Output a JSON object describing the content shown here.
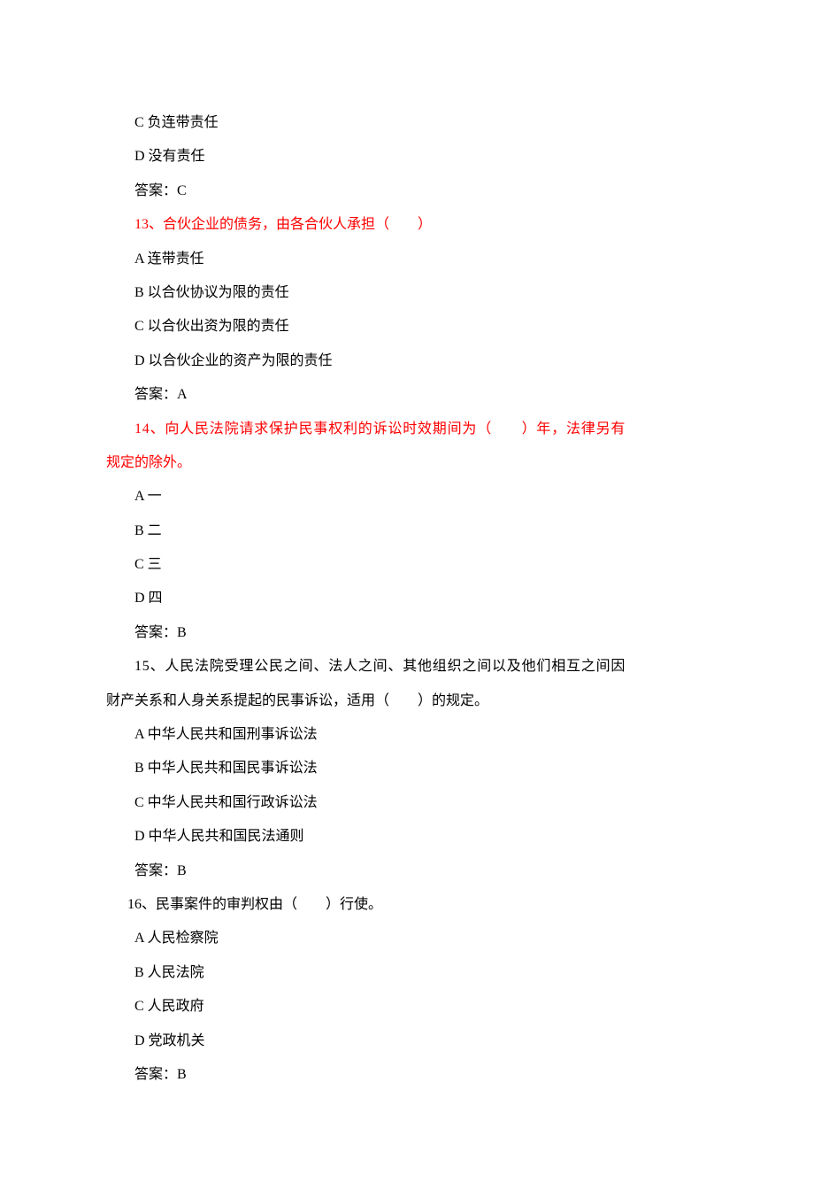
{
  "q12_tail": {
    "option_c": "C 负连带责任",
    "option_d": "D 没有责任",
    "answer": "答案：C"
  },
  "q13": {
    "stem": "13、合伙企业的债务，由各合伙人承担（　　）",
    "option_a": "A 连带责任",
    "option_b": "B 以合伙协议为限的责任",
    "option_c": "C 以合伙出资为限的责任",
    "option_d": "D 以合伙企业的资产为限的责任",
    "answer": "答案：A"
  },
  "q14": {
    "stem_line1": "14、向人民法院请求保护民事权利的诉讼时效期间为（　　）年，法律另有",
    "stem_line2": "规定的除外。",
    "option_a": "A 一",
    "option_b": "B 二",
    "option_c": "C 三",
    "option_d": "D 四",
    "answer": "答案：B"
  },
  "q15": {
    "stem_line1": "15、人民法院受理公民之间、法人之间、其他组织之间以及他们相互之间因",
    "stem_line2": "财产关系和人身关系提起的民事诉讼，适用（　　）的规定。",
    "option_a": "A 中华人民共和国刑事诉讼法",
    "option_b": "B 中华人民共和国民事诉讼法",
    "option_c": "C 中华人民共和国行政诉讼法",
    "option_d": "D 中华人民共和国民法通则",
    "answer": "答案：B"
  },
  "q16": {
    "stem": "16、民事案件的审判权由（　　）行使。",
    "option_a": "A 人民检察院",
    "option_b": "B 人民法院",
    "option_c": "C 人民政府",
    "option_d": "D 党政机关",
    "answer": "答案：B"
  }
}
